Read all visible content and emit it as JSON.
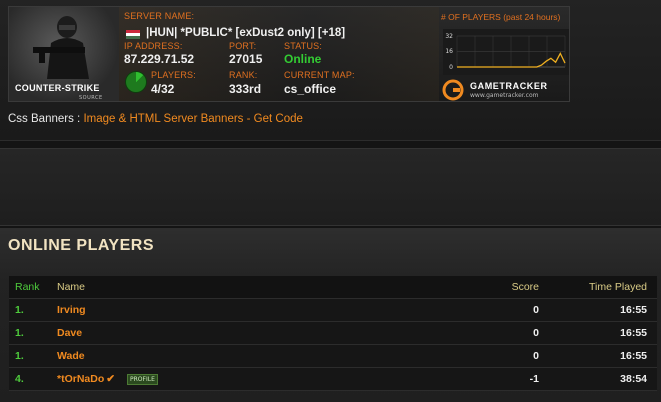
{
  "banner": {
    "game_logo_text": "Counter-Strike",
    "game_logo_sub": "SOURCE",
    "server_name_label": "SERVER NAME:",
    "server_name": "|HUN| *PUBLIC* [exDust2 only] [+18]",
    "ip_label": "IP ADDRESS:",
    "ip": "87.229.71.52",
    "port_label": "PORT:",
    "port": "27015",
    "status_label": "STATUS:",
    "status": "Online",
    "players_label": "PLAYERS:",
    "players": "4/32",
    "rank_label": "RANK:",
    "rank": "333rd",
    "map_label": "CURRENT MAP:",
    "map": "cs_office",
    "graph_title": "# OF PLAYERS (past 24 hours)",
    "graph_ticks": [
      "32",
      "16",
      "0"
    ],
    "gametracker_text": "GAMETRACKER",
    "gametracker_url": "www.gametracker.com",
    "flag_colors": [
      "#cd2a3e",
      "#ffffff",
      "#436f4d"
    ],
    "player_fill_fraction": 0.125
  },
  "chart_data": {
    "type": "area",
    "title": "# OF PLAYERS (past 24 hours)",
    "ylim": [
      0,
      32
    ],
    "yticks": [
      32,
      16,
      0
    ],
    "values": [
      0,
      0,
      0,
      0,
      0,
      0,
      0,
      0,
      0,
      0,
      0,
      0,
      0,
      0,
      0,
      0,
      0,
      0,
      2,
      6,
      9,
      5,
      14,
      4
    ]
  },
  "css_banner": {
    "label": "Css Banners :",
    "link": "Image & HTML Server Banners - Get Code"
  },
  "players_section": {
    "title": "ONLINE PLAYERS",
    "columns": {
      "rank": "Rank",
      "name": "Name",
      "score": "Score",
      "time": "Time Played"
    },
    "rows": [
      {
        "rank": "1.",
        "name": "Irving",
        "score": "0",
        "time": "16:55"
      },
      {
        "rank": "1.",
        "name": "Dave",
        "score": "0",
        "time": "16:55"
      },
      {
        "rank": "1.",
        "name": "Wade",
        "score": "0",
        "time": "16:55"
      },
      {
        "rank": "4.",
        "name": "*tOrNaDo",
        "score": "-1",
        "time": "38:54",
        "verified": "✔",
        "badge": "PROFILE"
      }
    ]
  },
  "colors": {
    "accent_orange": "#f08a20",
    "label_orange": "#e07020",
    "status_green": "#33cc33",
    "rank_green": "#4ecb3c",
    "header_gold": "#d9cb86"
  }
}
